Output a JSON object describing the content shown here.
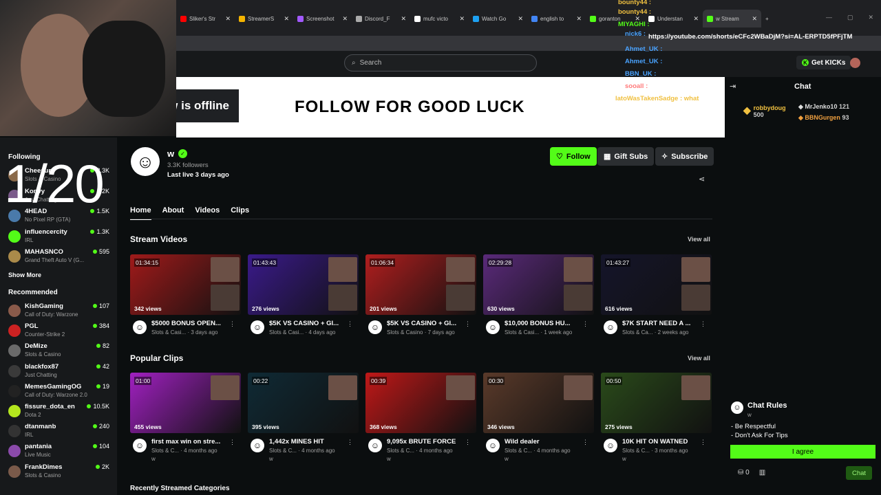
{
  "browser": {
    "tabs": [
      {
        "label": "Sliker's Str",
        "color": "#ff0000",
        "active": false
      },
      {
        "label": "StreamerS",
        "color": "#f4b400",
        "active": false
      },
      {
        "label": "Screenshot",
        "color": "#a259ff",
        "active": false
      },
      {
        "label": "Discord_F",
        "color": "#aaaaaa",
        "active": false
      },
      {
        "label": "mufc victo",
        "color": "#ffffff",
        "active": false
      },
      {
        "label": "Watch Go",
        "color": "#1da1f2",
        "active": false
      },
      {
        "label": "english to",
        "color": "#4285f4",
        "active": false
      },
      {
        "label": "goranton",
        "color": "#53fc18",
        "active": false
      },
      {
        "label": "Understan",
        "color": "#ffffff",
        "active": false
      },
      {
        "label": "w Stream",
        "color": "#53fc18",
        "active": true
      }
    ],
    "new_tab": "+",
    "window_controls": [
      "—",
      "▢",
      "✕"
    ]
  },
  "header": {
    "search_placeholder": "Search",
    "get_kicks": "Get KICKs"
  },
  "overlay_chat": {
    "lines": [
      {
        "name": "bounty44 :",
        "color": "#f0c040"
      },
      {
        "name": "bounty44 :",
        "color": "#f0c040"
      },
      {
        "name": "MIYAGHI :",
        "color": "#53fc18"
      },
      {
        "name": "nick6 :",
        "color": "#4aa3ff"
      },
      {
        "name": "Ahmet_UK :",
        "color": "#4aa3ff"
      },
      {
        "name": "Ahmet_UK :",
        "color": "#4aa3ff"
      },
      {
        "name": "BBN_UK :",
        "color": "#4aa3ff"
      },
      {
        "name": "sooall :",
        "color": "#ff7a7a"
      },
      {
        "name": "latoWasTakenSadge : what",
        "color": "#f0c040"
      }
    ],
    "url": "https://youtube.com/shorts/eCFc2WBaDjM?si=AL-ERPTD5fPFjTM"
  },
  "banner": {
    "offline": "w is offline",
    "text": "FOLLOW FOR GOOD LUCK"
  },
  "counter": "1/20",
  "sidebar": {
    "following_title": "Following",
    "following": [
      {
        "name": "Cheesur",
        "category": "Slots & Casino",
        "count": "8.3K",
        "color": "#8a6a4a"
      },
      {
        "name": "Konvy",
        "category": "Just Chatting",
        "count": "6.2K",
        "color": "#7a5a8a"
      },
      {
        "name": "4HEAD",
        "category": "No Pixel RP (GTA)",
        "count": "1.5K",
        "color": "#4a7aaa"
      },
      {
        "name": "influencercity",
        "category": "IRL",
        "count": "1.3K",
        "color": "#53fc18"
      },
      {
        "name": "MAHASNCO",
        "category": "Grand Theft Auto V (G...",
        "count": "595",
        "color": "#aa8a4a"
      }
    ],
    "show_more": "Show More",
    "recommended_title": "Recommended",
    "recommended": [
      {
        "name": "KishGaming",
        "category": "Call of Duty: Warzone",
        "count": "107",
        "color": "#8a5a4a"
      },
      {
        "name": "PGL",
        "category": "Counter-Strike 2",
        "count": "384",
        "color": "#cc2222"
      },
      {
        "name": "DeMize",
        "category": "Slots & Casino",
        "count": "82",
        "color": "#6a6a6a"
      },
      {
        "name": "blackfox87",
        "category": "Just Chatting",
        "count": "42",
        "color": "#3a3a3a"
      },
      {
        "name": "MemesGamingOG",
        "category": "Call of Duty: Warzone 2.0",
        "count": "19",
        "color": "#222222"
      },
      {
        "name": "fissure_dota_en",
        "category": "Dota 2",
        "count": "10.5K",
        "color": "#b4e61e"
      },
      {
        "name": "dtanmanb",
        "category": "IRL",
        "count": "240",
        "color": "#333333"
      },
      {
        "name": "pantania",
        "category": "Live Music",
        "count": "104",
        "color": "#8a4aaa"
      },
      {
        "name": "FrankDimes",
        "category": "Slots & Casino",
        "count": "2K",
        "color": "#7a5a4a"
      }
    ]
  },
  "channel": {
    "name": "w",
    "followers": "3.3K followers",
    "last_live": "Last live 3 days ago",
    "follow": "Follow",
    "gift_subs": "Gift Subs",
    "subscribe": "Subscribe",
    "tabs": [
      "Home",
      "About",
      "Videos",
      "Clips"
    ]
  },
  "stream_videos": {
    "title": "Stream Videos",
    "view_all": "View all",
    "items": [
      {
        "duration": "01:34:15",
        "views": "342 views",
        "title": "$5000 BONUS OPEN...",
        "category": "Slots & Casi...",
        "age": "3 days ago",
        "bg": "#a01a1a"
      },
      {
        "duration": "01:43:43",
        "views": "276 views",
        "title": "$5K VS CASINO + GI...",
        "category": "Slots & Casi...",
        "age": "4 days ago",
        "bg": "#3a1a8a"
      },
      {
        "duration": "01:06:34",
        "views": "201 views",
        "title": "$5K VS CASINO + GI...",
        "category": "Slots & Casino",
        "age": "7 days ago",
        "bg": "#b01e1e"
      },
      {
        "duration": "02:29:28",
        "views": "630 views",
        "title": "$10,000 BONUS HU...",
        "category": "Slots & Casi...",
        "age": "1 week ago",
        "bg": "#5a2a7a"
      },
      {
        "duration": "01:43:27",
        "views": "616 views",
        "title": "$7K START NEED A ...",
        "category": "Slots & Ca...",
        "age": "2 weeks ago",
        "bg": "#15152a"
      }
    ]
  },
  "popular_clips": {
    "title": "Popular Clips",
    "view_all": "View all",
    "items": [
      {
        "duration": "01:00",
        "views": "455 views",
        "title": "first max win on stre...",
        "category": "Slots & C...",
        "age": "4 months ago",
        "by": "w",
        "bg": "#a020c0"
      },
      {
        "duration": "00:22",
        "views": "395 views",
        "title": "1,442x MINES HIT",
        "category": "Slots & C...",
        "age": "4 months ago",
        "by": "w",
        "bg": "#0f2a35"
      },
      {
        "duration": "00:39",
        "views": "368 views",
        "title": "9,095x BRUTE FORCE",
        "category": "Slots & C...",
        "age": "4 months ago",
        "by": "w",
        "bg": "#c01818"
      },
      {
        "duration": "00:30",
        "views": "346 views",
        "title": "Wild dealer",
        "category": "Slots & C...",
        "age": "4 months ago",
        "by": "w",
        "bg": "#5a3a2a"
      },
      {
        "duration": "00:50",
        "views": "275 views",
        "title": "10K HIT ON WATNED",
        "category": "Slots & C...",
        "age": "3 months ago",
        "by": "w",
        "bg": "#2a4a1a"
      }
    ]
  },
  "bottom_section": "Recently Streamed Categories",
  "chat": {
    "title": "Chat",
    "gifters": [
      {
        "name": "robbydoug",
        "count": "500",
        "color": "#f0c040"
      },
      {
        "name": "MrJenko10",
        "count": "121",
        "color": "#dddddd"
      },
      {
        "name": "BBNGurgen",
        "count": "93",
        "color": "#f0a040"
      }
    ],
    "rules_title": "Chat Rules",
    "rules_channel": "w",
    "rules": [
      "- Be Respectful",
      "- Don't Ask For Tips"
    ],
    "agree": "I agree",
    "kicks_count": "0",
    "chat_button": "Chat"
  }
}
